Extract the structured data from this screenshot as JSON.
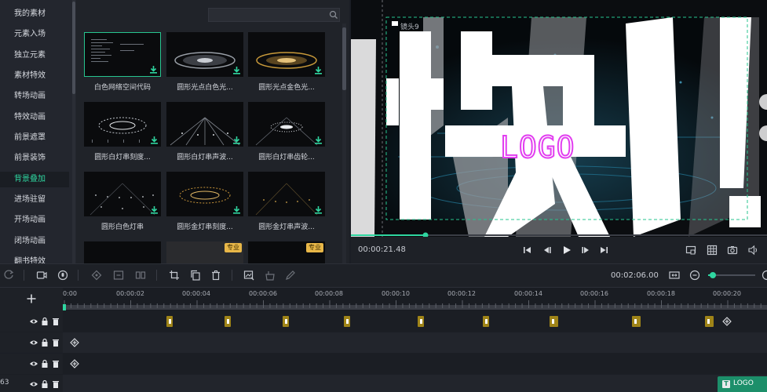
{
  "sidebar": {
    "items": [
      {
        "label": "我的素材"
      },
      {
        "label": "元素入场"
      },
      {
        "label": "独立元素"
      },
      {
        "label": "素材特效"
      },
      {
        "label": "转场动画"
      },
      {
        "label": "特效动画"
      },
      {
        "label": "前景遮罩"
      },
      {
        "label": "前景装饰"
      },
      {
        "label": "背景叠加",
        "active": true
      },
      {
        "label": "进场驻留"
      },
      {
        "label": "开场动画"
      },
      {
        "label": "闭场动画"
      },
      {
        "label": "翻书特效"
      }
    ]
  },
  "library": {
    "search_placeholder": "",
    "tiles": [
      {
        "caption": "白色网络空间代码"
      },
      {
        "caption": "圆形光点白色光..."
      },
      {
        "caption": "圆形光点金色光..."
      },
      {
        "caption": "圆形白灯串刻度..."
      },
      {
        "caption": "圆形白灯串声波..."
      },
      {
        "caption": "圆形白灯串齿轮..."
      },
      {
        "caption": "圆形白色灯串"
      },
      {
        "caption": "圆形金灯串刻度..."
      },
      {
        "caption": "圆形金灯串声波..."
      },
      {
        "caption": ""
      },
      {
        "caption": "",
        "badge": "专业"
      },
      {
        "caption": "",
        "badge": "专业"
      }
    ]
  },
  "preview": {
    "lens_label": "镜头9",
    "big_text": "快",
    "logo_text": "LOGO",
    "current_time": "00:00:21.48",
    "playhead_fraction": 0.18
  },
  "toolbar": {
    "total_time": "00:02:06.00",
    "zoom_fraction": 0.1
  },
  "timeline": {
    "ticks": [
      "0:00",
      "00:00:02",
      "00:00:04",
      "00:00:06",
      "00:00:08",
      "00:00:10",
      "00:00:12",
      "00:00:14",
      "00:00:16",
      "00:00:18",
      "00:00:20"
    ],
    "track1_keyframes": 9,
    "track4_label": "63",
    "clip_label": "LOGO"
  },
  "colors": {
    "accent": "#2fd6a0",
    "logo": "#e23ef0",
    "pro_badge": "#e8b748",
    "keyframe": "#9f8418"
  }
}
